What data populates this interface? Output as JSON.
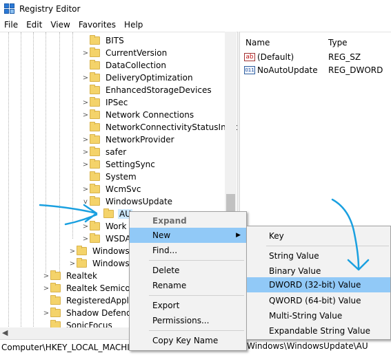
{
  "window": {
    "title": "Registry Editor"
  },
  "menubar": [
    "File",
    "Edit",
    "View",
    "Favorites",
    "Help"
  ],
  "tree": {
    "items": [
      {
        "label": "BITS",
        "chevron": ""
      },
      {
        "label": "CurrentVersion",
        "chevron": ">"
      },
      {
        "label": "DataCollection",
        "chevron": ""
      },
      {
        "label": "DeliveryOptimization",
        "chevron": ">"
      },
      {
        "label": "EnhancedStorageDevices",
        "chevron": ""
      },
      {
        "label": "IPSec",
        "chevron": ">"
      },
      {
        "label": "Network Connections",
        "chevron": ">"
      },
      {
        "label": "NetworkConnectivityStatusIndic",
        "chevron": ""
      },
      {
        "label": "NetworkProvider",
        "chevron": ">"
      },
      {
        "label": "safer",
        "chevron": ">"
      },
      {
        "label": "SettingSync",
        "chevron": ">"
      },
      {
        "label": "System",
        "chevron": ""
      },
      {
        "label": "WcmSvc",
        "chevron": ">"
      },
      {
        "label": "WindowsUpdate",
        "chevron": "v"
      },
      {
        "label": "AU",
        "chevron": ""
      },
      {
        "label": "Work",
        "chevron": ">"
      },
      {
        "label": "WSDA",
        "chevron": ">"
      },
      {
        "label": "Windows",
        "chevron": ">"
      },
      {
        "label": "Windows",
        "chevron": ">"
      },
      {
        "label": "Realtek",
        "chevron": ">"
      },
      {
        "label": "Realtek Semicon",
        "chevron": ">"
      },
      {
        "label": "RegisteredApplic",
        "chevron": ""
      },
      {
        "label": "Shadow Defende",
        "chevron": ">"
      },
      {
        "label": "SonicFocus",
        "chevron": ""
      }
    ]
  },
  "list": {
    "headers": {
      "name": "Name",
      "type": "Type"
    },
    "rows": [
      {
        "icon": "string-value-icon",
        "name": "(Default)",
        "type": "REG_SZ"
      },
      {
        "icon": "binary-value-icon",
        "name": "NoAutoUpdate",
        "type": "REG_DWORD"
      }
    ]
  },
  "context_menu": {
    "items": [
      {
        "label": "Expand",
        "state": "disabled-bold"
      },
      {
        "label": "New",
        "state": "highlighted",
        "submenu": true
      },
      {
        "label": "Find...",
        "state": "normal"
      },
      {
        "label": "Delete",
        "state": "normal"
      },
      {
        "label": "Rename",
        "state": "normal"
      },
      {
        "label": "Export",
        "state": "normal"
      },
      {
        "label": "Permissions...",
        "state": "normal"
      },
      {
        "label": "Copy Key Name",
        "state": "normal"
      }
    ]
  },
  "submenu": {
    "items": [
      {
        "label": "Key",
        "state": "normal"
      },
      {
        "label": "String Value",
        "state": "normal"
      },
      {
        "label": "Binary Value",
        "state": "normal"
      },
      {
        "label": "DWORD (32-bit) Value",
        "state": "highlighted"
      },
      {
        "label": "QWORD (64-bit) Value",
        "state": "normal"
      },
      {
        "label": "Multi-String Value",
        "state": "normal"
      },
      {
        "label": "Expandable String Value",
        "state": "normal"
      }
    ]
  },
  "statusbar": {
    "path_left": "Computer\\HKEY_LOCAL_MACHINE",
    "path_right": "Windows\\WindowsUpdate\\AU"
  },
  "colors": {
    "highlight": "#91c9f7",
    "selection": "#cce8ff",
    "annotation_arrow": "#1aa0e0",
    "folder": "#f4d36a"
  }
}
